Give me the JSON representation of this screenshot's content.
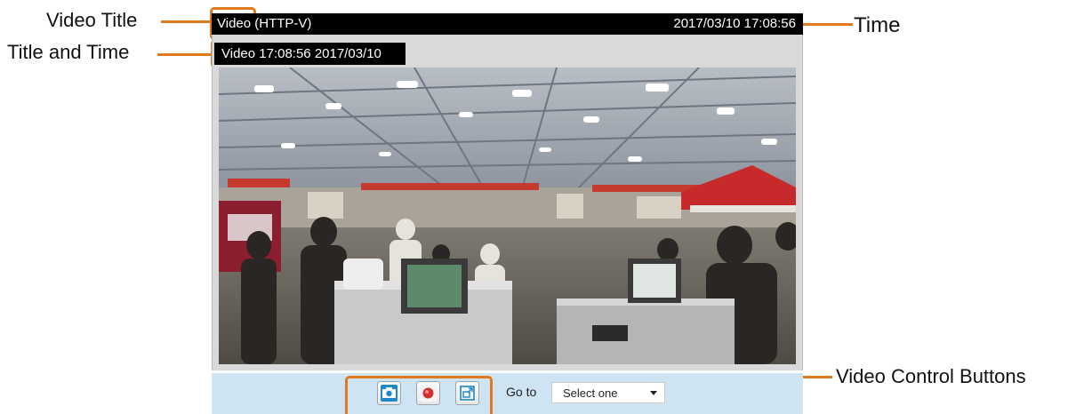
{
  "callouts": {
    "video_title": "Video Title",
    "title_and_time": "Title and Time",
    "time": "Time",
    "video_control_buttons": "Video Control Buttons"
  },
  "player": {
    "title": "Video",
    "stream": " (HTTP-V)",
    "timestamp": "2017/03/10  17:08:56",
    "overlay": "Video 17:08:56  2017/03/10"
  },
  "controls": {
    "buttons": [
      {
        "icon": "camera-icon",
        "action": "snapshot"
      },
      {
        "icon": "record-icon",
        "action": "record"
      },
      {
        "icon": "fullscreen-icon",
        "action": "fullscreen"
      }
    ],
    "goto_label": "Go to",
    "goto_selected": "Select one"
  },
  "colors": {
    "callout_accent": "#e07a1f",
    "title_bar": "#000000",
    "control_bar": "#cfe4f3",
    "camera_button": "#1e88c8",
    "record_button": "#d32f2f"
  }
}
